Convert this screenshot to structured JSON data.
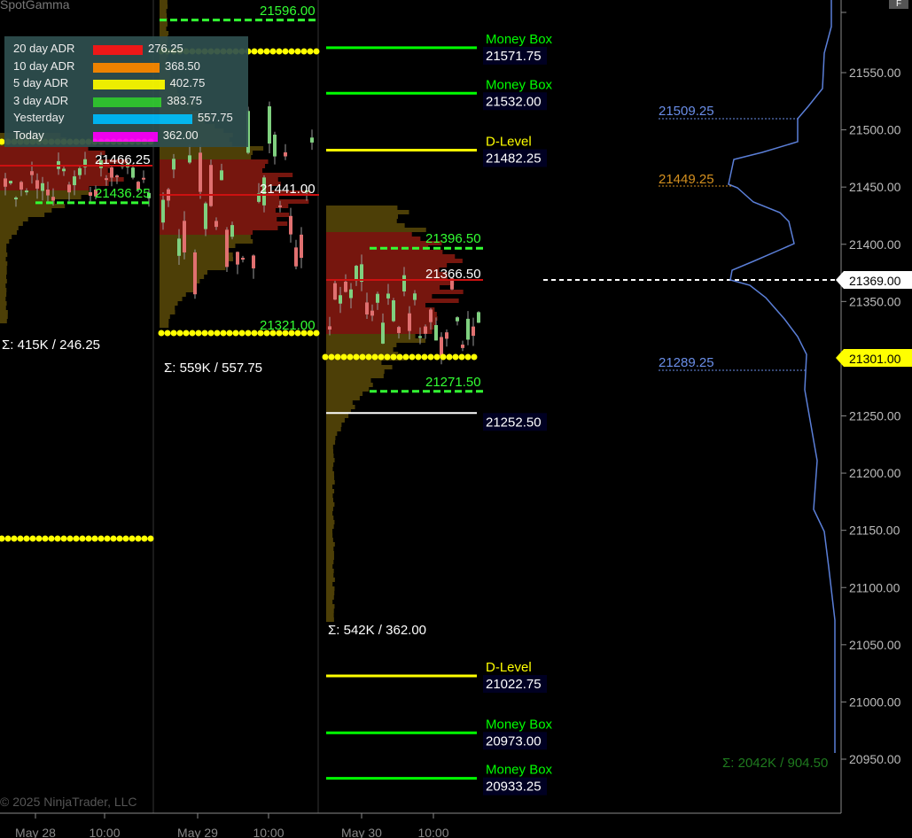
{
  "app": {
    "watermark": "SpotGamma",
    "copyright": "© 2025 NinjaTrader, LLC",
    "corner_button": "F"
  },
  "adr_legend": [
    {
      "label": "20 day ADR",
      "value": "276.25",
      "color": "#ff1a1a",
      "fill": 0.5
    },
    {
      "label": "10 day ADR",
      "value": "368.50",
      "color": "#ff8c00",
      "fill": 0.67
    },
    {
      "label": "5 day ADR",
      "value": "402.75",
      "color": "#ffff00",
      "fill": 0.72
    },
    {
      "label": "3 day ADR",
      "value": "383.75",
      "color": "#33cc33",
      "fill": 0.69
    },
    {
      "label": "Yesterday",
      "value": "557.75",
      "color": "#00bfff",
      "fill": 1.0
    },
    {
      "label": "Today",
      "value": "362.00",
      "color": "#ff00ff",
      "fill": 0.65
    }
  ],
  "price_axis": {
    "ticks": [
      "21550.00",
      "21500.00",
      "21450.00",
      "21400.00",
      "21350.00",
      "21300.00",
      "21250.00",
      "21200.00",
      "21150.00",
      "21100.00",
      "21050.00",
      "21000.00",
      "20950.00"
    ],
    "current_price": "21369.00",
    "yellow_marker": "21301.00"
  },
  "time_axis": {
    "labels": [
      "May 28",
      "10:00",
      "May 29",
      "10:00",
      "May 30",
      "10:00"
    ]
  },
  "levels": [
    {
      "type": "Money Box",
      "value": "21571.75",
      "color": "#00ff00"
    },
    {
      "type": "Money Box",
      "value": "21532.00",
      "color": "#00ff00"
    },
    {
      "type": "D-Level",
      "value": "21482.25",
      "color": "#ffff00"
    },
    {
      "type": "D-Level",
      "value": "21022.75",
      "color": "#ffff00"
    },
    {
      "type": "Money Box",
      "value": "20973.00",
      "color": "#00ff00"
    },
    {
      "type": "Money Box",
      "value": "20933.25",
      "color": "#00ff00"
    }
  ],
  "white_level": "21252.50",
  "session_labels": {
    "s1_high": "21596.00",
    "s1_poc": "21466.25",
    "s1_low": "21436.25",
    "s1_sum": "Σ: 415K / 246.25",
    "s2_poc": "21441.00",
    "s2_low": "21321.00",
    "s2_sum": "Σ: 559K / 557.75",
    "s3_high": "21396.50",
    "s3_poc": "21366.50",
    "s3_low": "21271.50",
    "s3_sum": "Σ: 542K / 362.00"
  },
  "gamma_profile": {
    "label_top": "21509.25",
    "label_mid": "21449.25",
    "label_low": "21289.25",
    "sum": "Σ: 2042K / 904.50",
    "colors": {
      "top": "#6a8ee8",
      "mid": "#d4901f",
      "low": "#6a8ee8",
      "sum": "#1e7a1e"
    }
  }
}
